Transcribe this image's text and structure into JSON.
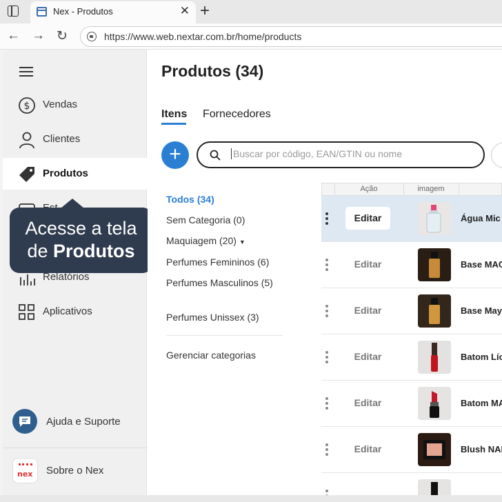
{
  "browser": {
    "tab_title": "Nex - Produtos",
    "url": "https://www.web.nextar.com.br/home/products"
  },
  "sidebar": {
    "items": [
      {
        "label": "Vendas",
        "icon": "dollar-icon"
      },
      {
        "label": "Clientes",
        "icon": "person-icon"
      },
      {
        "label": "Produtos",
        "icon": "tag-icon",
        "active": true
      },
      {
        "label": "Est",
        "icon": "box-icon"
      },
      {
        "label": "Relatórios",
        "icon": "bar-chart-icon"
      },
      {
        "label": "Aplicativos",
        "icon": "apps-grid-icon"
      }
    ],
    "help_label": "Ajuda e Suporte",
    "about_label": "Sobre o Nex",
    "logo_text": "nex"
  },
  "tooltip": {
    "line1": "Acesse a tela",
    "line2_prefix": "de ",
    "line2_bold": "Produtos"
  },
  "main": {
    "title": "Produtos (34)",
    "tabs": [
      {
        "label": "Itens",
        "active": true
      },
      {
        "label": "Fornecedores"
      }
    ],
    "search_placeholder": "Buscar por código, EAN/GTIN ou nome",
    "categories": [
      {
        "label": "Todos (34)",
        "active": true
      },
      {
        "label": "Sem Categoria (0)"
      },
      {
        "label": "Maquiagem (20)"
      },
      {
        "label": "Perfumes Femininos (6)"
      },
      {
        "label": "Perfumes Masculinos (5)"
      },
      {
        "label": "Perfumes Unissex (3)"
      }
    ],
    "manage_categories": "Gerenciar categorias",
    "table": {
      "headers": [
        "Ação",
        "imagem"
      ],
      "edit_label": "Editar",
      "rows": [
        {
          "name": "Água Mic",
          "selected": true
        },
        {
          "name": "Base MAC"
        },
        {
          "name": "Base May"
        },
        {
          "name": "Batom Líc"
        },
        {
          "name": "Batom MA"
        },
        {
          "name": "Blush NAR"
        }
      ]
    }
  },
  "colors": {
    "accent": "#2b7fd3",
    "tooltip_bg": "#2f3b4e",
    "selected_row": "#dde8f2"
  }
}
